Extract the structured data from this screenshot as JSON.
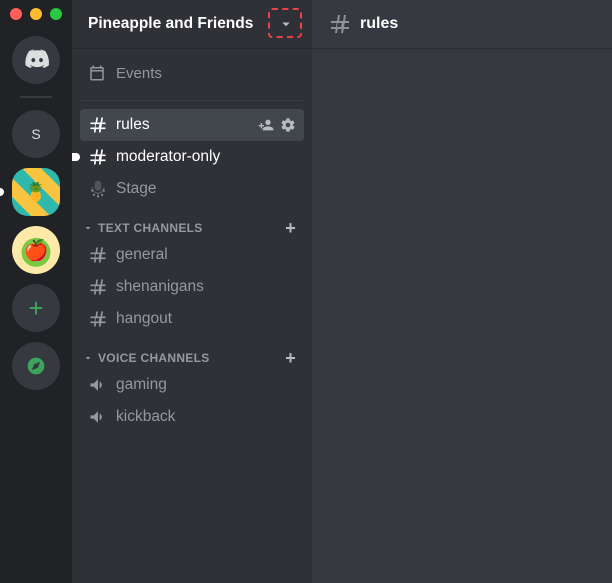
{
  "server": {
    "name": "Pineapple and Friends"
  },
  "events_label": "Events",
  "top_channels": {
    "rules": "rules",
    "moderator": "moderator-only",
    "stage": "Stage"
  },
  "categories": {
    "text": {
      "label": "TEXT CHANNELS",
      "items": [
        "general",
        "shenanigans",
        "hangout"
      ]
    },
    "voice": {
      "label": "VOICE CHANNELS",
      "items": [
        "gaming",
        "kickback"
      ]
    }
  },
  "current_channel": "rules",
  "rail": {
    "initial": "S"
  }
}
